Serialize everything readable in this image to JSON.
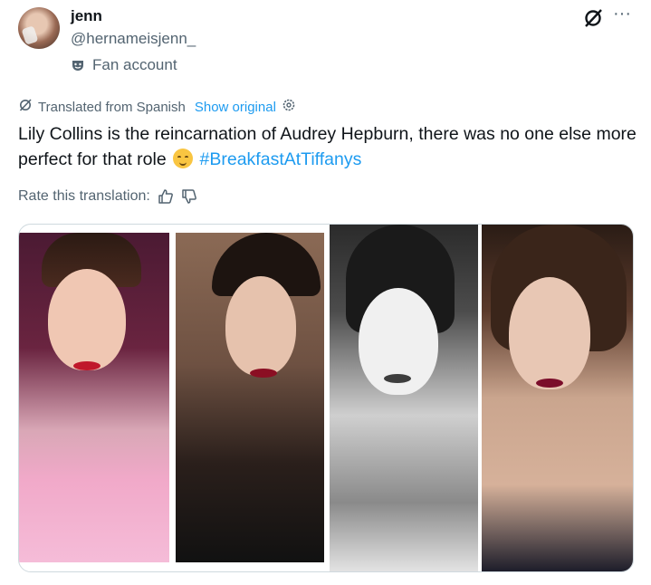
{
  "user": {
    "display_name": "jenn",
    "handle": "@hernameisjenn_",
    "label": "Fan account"
  },
  "translation": {
    "note": "Translated from Spanish",
    "show_original": "Show original",
    "rate_label": "Rate this translation:"
  },
  "tweet": {
    "text_main": "Lily Collins is the reincarnation of Audrey Hepburn, there was no one else more perfect for that role",
    "hashtag": "#BreakfastAtTiffanys"
  },
  "icons": {
    "grok": "grok-icon",
    "more": "more-icon",
    "mask": "mask-icon",
    "translate": "translate-icon",
    "gear": "gear-icon",
    "thumbs_up": "thumbs-up-icon",
    "thumbs_down": "thumbs-down-icon",
    "emoji": "relieved-face-emoji"
  },
  "colors": {
    "accent": "#1d9bf0",
    "secondary_text": "#536471",
    "primary_text": "#0f1419"
  }
}
